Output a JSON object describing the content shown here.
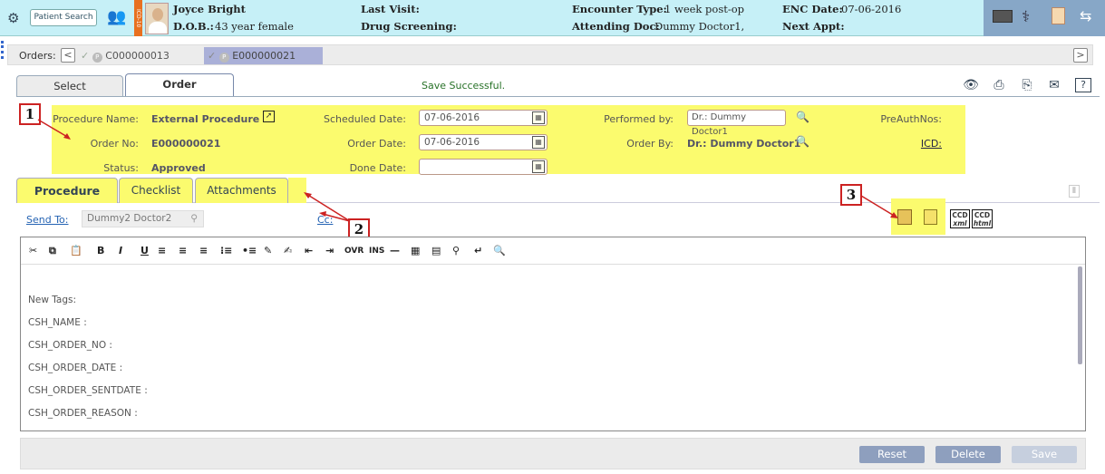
{
  "header": {
    "search_label": "Patient Search",
    "vertical_tab": "ICD-10",
    "patient_name": "Joyce Bright",
    "dob_label": "D.O.B.:",
    "dob_value": "43 year female",
    "last_visit_label": "Last Visit:",
    "drug_screening_label": "Drug Screening:",
    "encounter_type_label": "Encounter Type:",
    "encounter_type_value": "1 week post-op",
    "attending_label": "Attending Doc:",
    "attending_value": "Dummy Doctor1,",
    "enc_date_label": "ENC Date:",
    "enc_date_value": "07-06-2016",
    "next_appt_label": "Next Appt:"
  },
  "orders": {
    "label": "Orders:",
    "prev": "<",
    "next": ">",
    "items": [
      {
        "badge": "P",
        "code": "C000000013"
      },
      {
        "badge": "P",
        "code": "E000000021"
      }
    ]
  },
  "top_tabs": {
    "select": "Select",
    "order": "Order"
  },
  "status_message": "Save Successful.",
  "form": {
    "procedure_name_label": "Procedure Name:",
    "procedure_name_value": "External Procedure",
    "order_no_label": "Order No:",
    "order_no_value": "E000000021",
    "status_label": "Status:",
    "status_value": "Approved",
    "scheduled_date_label": "Scheduled Date:",
    "scheduled_date_value": "07-06-2016",
    "order_date_label": "Order Date:",
    "order_date_value": "07-06-2016",
    "done_date_label": "Done Date:",
    "done_date_value": "",
    "performed_by_label": "Performed by:",
    "performed_by_value": "Dr.: Dummy  Doctor1",
    "order_by_label": "Order By:",
    "order_by_value": "Dr.: Dummy Doctor1",
    "preauth_label": "PreAuthNos:",
    "icd_label": "ICD:"
  },
  "callouts": [
    "1",
    "2",
    "3"
  ],
  "procedure_tabs": [
    "Procedure",
    "Checklist",
    "Attachments"
  ],
  "send_to": {
    "label": "Send To:",
    "value": "Dummy2 Doctor2",
    "cc_label": "Cc:"
  },
  "ccd": {
    "xml_top": "CCD",
    "xml_bottom": "xml",
    "html_top": "CCD",
    "html_bottom": "html"
  },
  "toolbar": {
    "bold": "B",
    "italic": "I",
    "underline": "U",
    "ovr": "OVR",
    "ins": "INS"
  },
  "editor": {
    "lines": [
      "New Tags:",
      "CSH_NAME :",
      "CSH_ORDER_NO :",
      "CSH_ORDER_DATE :",
      "CSH_ORDER_SENTDATE :",
      "CSH_ORDER_REASON :"
    ]
  },
  "buttons": {
    "reset": "Reset",
    "delete": "Delete",
    "save": "Save"
  },
  "colors": {
    "header_bg": "#c6f0f7",
    "highlight": "#fbfb6e",
    "callout_border": "#cc2222",
    "button": "#8e9fbe"
  }
}
